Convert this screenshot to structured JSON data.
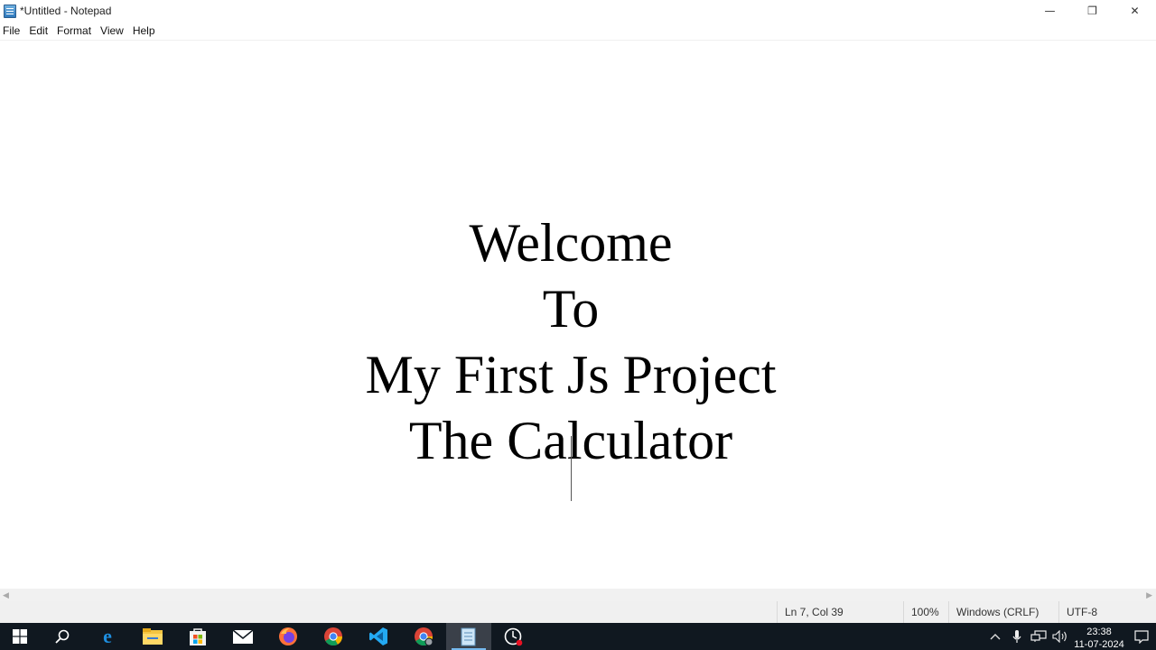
{
  "window": {
    "title": "*Untitled - Notepad",
    "minimize_glyph": "—",
    "restore_glyph": "❐",
    "close_glyph": "✕"
  },
  "menu": [
    "File",
    "Edit",
    "Format",
    "View",
    "Help"
  ],
  "document": {
    "lines": [
      "Welcome",
      "To",
      "My First Js Project",
      "The Calculator"
    ]
  },
  "status": {
    "position": "Ln 7, Col 39",
    "zoom": "100%",
    "line_ending": "Windows (CRLF)",
    "encoding": "UTF-8"
  },
  "taskbar": {
    "apps": [
      {
        "name": "windows-start-icon",
        "active": false
      },
      {
        "name": "search-icon",
        "active": false
      },
      {
        "name": "edge-icon",
        "active": false
      },
      {
        "name": "file-explorer-icon",
        "active": false
      },
      {
        "name": "microsoft-store-icon",
        "active": false
      },
      {
        "name": "mail-icon",
        "active": false
      },
      {
        "name": "firefox-icon",
        "active": false
      },
      {
        "name": "chrome-icon",
        "active": false
      },
      {
        "name": "vscode-icon",
        "active": false
      },
      {
        "name": "chrome-profile-icon",
        "active": false
      },
      {
        "name": "notepad-icon",
        "active": true
      },
      {
        "name": "screen-recorder-icon",
        "active": false
      }
    ],
    "clock_time": "23:38",
    "clock_date": "11-07-2024"
  },
  "colors": {
    "taskbar_bg": "#101820",
    "active_accent": "#76b9ed"
  }
}
